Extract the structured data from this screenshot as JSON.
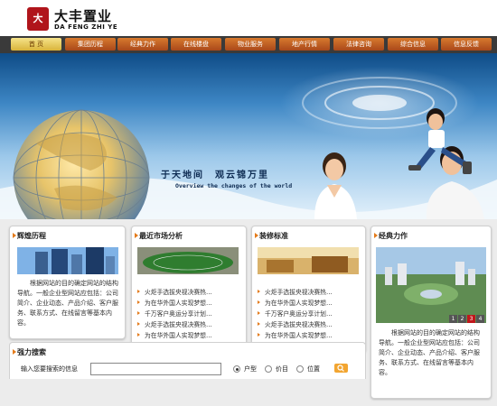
{
  "brand": {
    "seal_text": "大",
    "name_cn": "大丰置业",
    "name_en": "DA FENG ZHI YE"
  },
  "nav": [
    "首 页",
    "集团历程",
    "经典力作",
    "在线楼盘",
    "物业服务",
    "地产行情",
    "法律咨询",
    "综合信息",
    "信息反馈"
  ],
  "banner": {
    "slogan": "于天地间　观云锦万里",
    "slogan_en": "Overview the changes of the world"
  },
  "panels": {
    "history": {
      "title": "辉煌历程",
      "text": "根据网站的目的确定网站的结构导航。一般企业型网站应包括：公司简介、企业动态、产品介绍、客户服务、联系方式、在线留言等基本内容。"
    },
    "market": {
      "title": "最近市场分析",
      "items": [
        "火炬手选拔央视决赛热…",
        "为在华外国人实现梦想…",
        "千万客户奥运分享计划…",
        "火炬手选拔央视决赛热…",
        "为在华外国人实现梦想…"
      ]
    },
    "decor": {
      "title": "装修标准",
      "items": [
        "火炬手选拔央视决赛热…",
        "为在华外国人实现梦想…",
        "千万客户奥运分享计划…",
        "火炬手选拔央视决赛热…",
        "为在华外国人实现梦想…"
      ]
    },
    "works": {
      "title": "经典力作",
      "pages": [
        "1",
        "2",
        "3",
        "4"
      ],
      "current_page": "3",
      "text": "根据网站的目的确定网站的结构导航。一般企业型网站应包括：公司简介、企业动态、产品介绍、客户服务、联系方式、在线留言等基本内容。"
    }
  },
  "search": {
    "title": "强力搜索",
    "label": "输入您要搜索的信息",
    "options": [
      "户型",
      "价目",
      "位置"
    ],
    "selected": "户型",
    "query": ""
  },
  "colors": {
    "accent": "#e47b1b",
    "nav_bar": "#3a3a3a",
    "brand_red": "#b0151b"
  },
  "icons": [
    "arrow-icon",
    "search-icon"
  ]
}
